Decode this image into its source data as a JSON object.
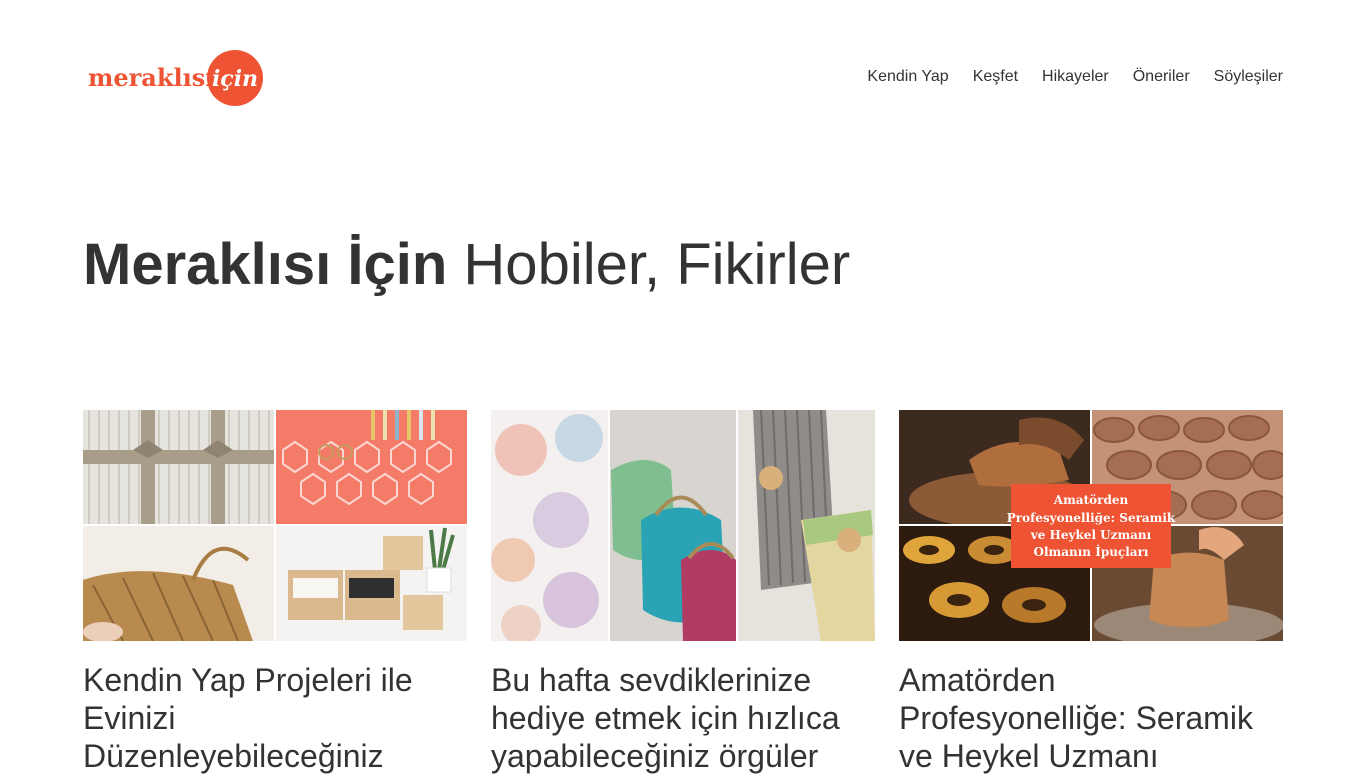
{
  "logo": {
    "word": "meraklısı",
    "badge": "için",
    "brand_color": "#ee5433"
  },
  "nav": {
    "items": [
      {
        "label": "Kendin Yap"
      },
      {
        "label": "Keşfet"
      },
      {
        "label": "Hikayeler"
      },
      {
        "label": "Öneriler"
      },
      {
        "label": "Söyleşiler"
      }
    ]
  },
  "hero": {
    "strong": "Meraklısı İçin",
    "light": "Hobiler, Fikirler"
  },
  "cards": [
    {
      "title": "Kendin Yap Projeleri ile Evinizi Düzenleyebileceğiniz",
      "image": "diy-collage-boxes-basket-crates"
    },
    {
      "title": "Bu hafta sevdiklerinize hediye etmek için hızlıca yapabileceğiniz örgüler",
      "image": "knitting-collage-scrunchies-purses"
    },
    {
      "title": "Amatörden Profesyonelliğe: Seramik ve Heykel Uzmanı",
      "image": "pottery-collage",
      "overlay": "Amatörden Profesyonelliğe: Seramik ve Heykel Uzmanı Olmanın İpuçları"
    }
  ]
}
